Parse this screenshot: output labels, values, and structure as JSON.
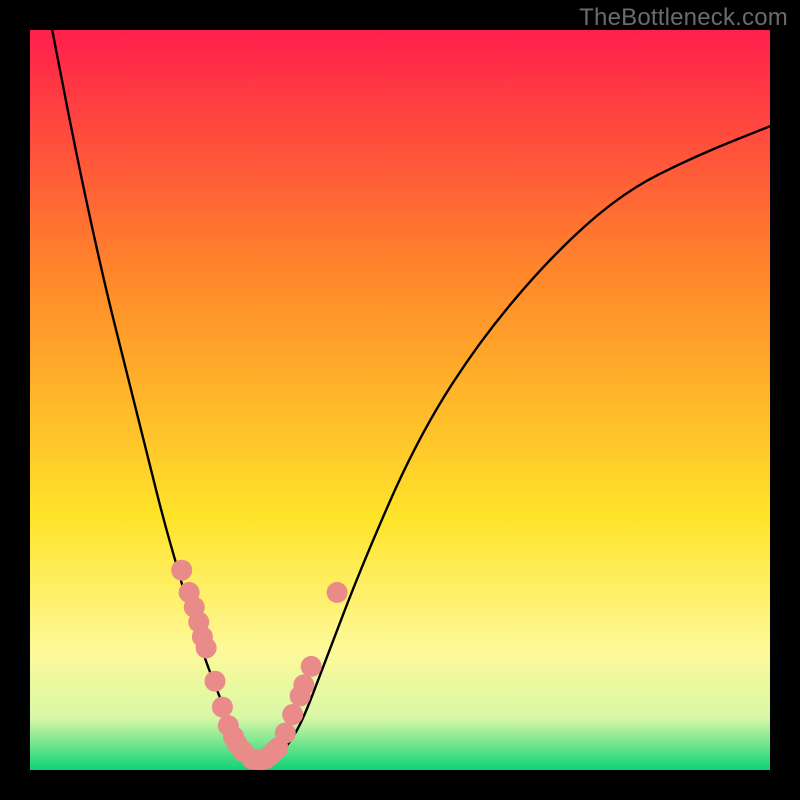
{
  "watermark": "TheBottleneck.com",
  "chart_data": {
    "type": "line",
    "title": "",
    "xlabel": "",
    "ylabel": "",
    "x_range": [
      0,
      100
    ],
    "y_range": [
      0,
      100
    ],
    "gradient_colors": {
      "top": "#ff1f4b",
      "mid_upper": "#ff8a2a",
      "mid": "#ffe42a",
      "mid_lower": "#fdf99a",
      "near_bottom": "#d8f7a6",
      "bottom": "#0dd376"
    },
    "curve_color": "#000000",
    "marker_color": "#e98b88",
    "series": [
      {
        "name": "v-curve",
        "x": [
          3,
          6.5,
          10,
          13,
          16,
          18,
          20,
          22,
          24,
          26,
          27,
          28,
          29,
          30,
          31,
          33,
          35,
          37,
          40,
          45,
          52,
          60,
          70,
          80,
          90,
          100
        ],
        "y": [
          100,
          82,
          66,
          54,
          42,
          34,
          27,
          20,
          14,
          9,
          6,
          4,
          2.5,
          1.2,
          1.0,
          1.5,
          3.5,
          7,
          15,
          28,
          44,
          57,
          69,
          78,
          83,
          87
        ]
      }
    ],
    "markers": {
      "name": "data-points",
      "points": [
        {
          "x": 20.5,
          "y": 27
        },
        {
          "x": 21.5,
          "y": 24
        },
        {
          "x": 22.2,
          "y": 22
        },
        {
          "x": 22.8,
          "y": 20
        },
        {
          "x": 23.3,
          "y": 18
        },
        {
          "x": 23.8,
          "y": 16.5
        },
        {
          "x": 25.0,
          "y": 12
        },
        {
          "x": 26.0,
          "y": 8.5
        },
        {
          "x": 26.8,
          "y": 6
        },
        {
          "x": 27.5,
          "y": 4.5
        },
        {
          "x": 28.0,
          "y": 3.5
        },
        {
          "x": 28.8,
          "y": 2.5
        },
        {
          "x": 30.0,
          "y": 1.5
        },
        {
          "x": 31.0,
          "y": 1.3
        },
        {
          "x": 31.8,
          "y": 1.5
        },
        {
          "x": 32.5,
          "y": 2.0
        },
        {
          "x": 33.0,
          "y": 2.5
        },
        {
          "x": 33.5,
          "y": 3.0
        },
        {
          "x": 34.5,
          "y": 5.0
        },
        {
          "x": 35.5,
          "y": 7.5
        },
        {
          "x": 36.5,
          "y": 10
        },
        {
          "x": 37.0,
          "y": 11.5
        },
        {
          "x": 38.0,
          "y": 14
        },
        {
          "x": 41.5,
          "y": 24
        }
      ]
    }
  }
}
